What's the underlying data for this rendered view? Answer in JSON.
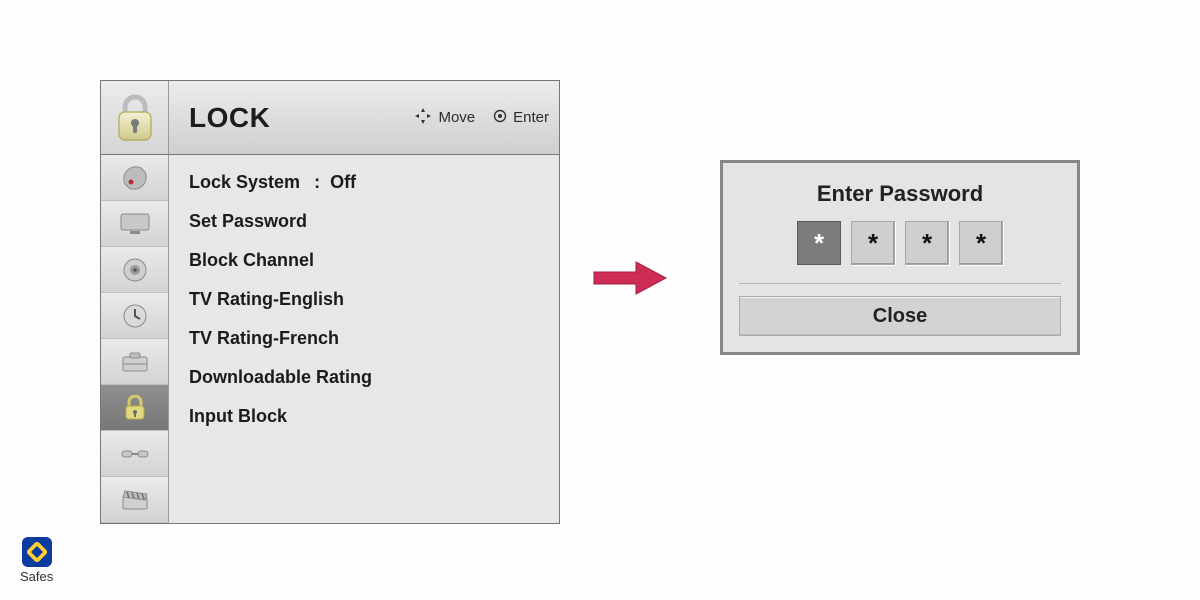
{
  "header": {
    "title": "LOCK",
    "hints": {
      "move": "Move",
      "enter": "Enter"
    }
  },
  "menu": {
    "items": [
      {
        "label": "Lock System",
        "value": "Off"
      },
      {
        "label": "Set Password"
      },
      {
        "label": "Block Channel"
      },
      {
        "label": "TV Rating-English"
      },
      {
        "label": "TV Rating-French"
      },
      {
        "label": "Downloadable Rating"
      },
      {
        "label": "Input Block"
      }
    ]
  },
  "side_icons": [
    "satellite-icon",
    "tv-icon",
    "audio-icon",
    "clock-icon",
    "toolbox-icon",
    "lock-icon",
    "cable-icon",
    "clapper-icon"
  ],
  "password_dialog": {
    "title": "Enter Password",
    "chars": [
      "*",
      "*",
      "*",
      "*"
    ],
    "close_label": "Close"
  },
  "watermark": {
    "label": "Safes"
  }
}
